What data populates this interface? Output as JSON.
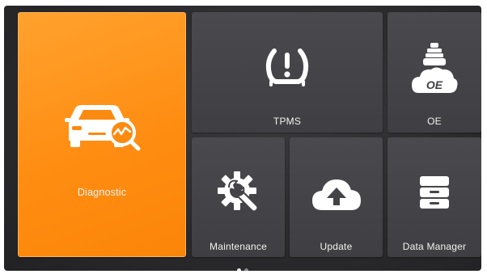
{
  "tiles": {
    "diagnostic": {
      "label": "Diagnostic",
      "icon": "car-diagnostic-icon"
    },
    "tpms": {
      "label": "TPMS",
      "icon": "tire-pressure-warning-icon"
    },
    "oe": {
      "label": "OE",
      "icon_text": "OE",
      "icon": "oe-badge-icon"
    },
    "maintenance": {
      "label": "Maintenance",
      "icon": "wrench-gear-icon"
    },
    "update": {
      "label": "Update",
      "icon": "cloud-upload-icon"
    },
    "data_manager": {
      "label": "Data Manager",
      "icon": "file-cabinet-icon"
    }
  },
  "pager": {
    "pages": 2,
    "current": 1
  },
  "colors": {
    "accent": "#ff8d12",
    "tile": "#444448",
    "background": "#2a2a2d",
    "icon": "#ffffff"
  }
}
